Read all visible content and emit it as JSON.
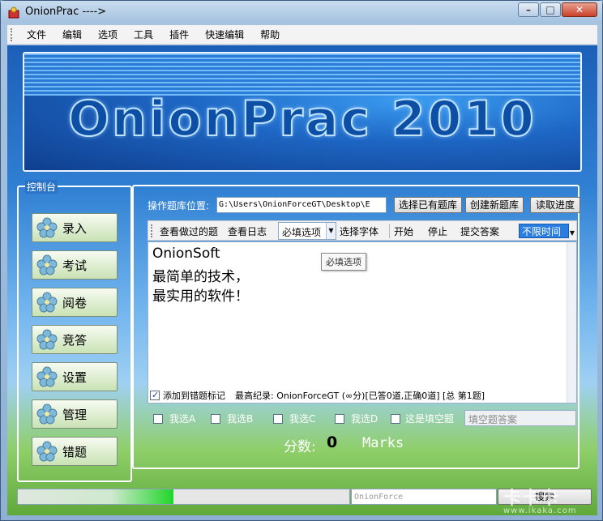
{
  "window": {
    "title": "OnionPrac ---->",
    "accent_color": "#2a7de1"
  },
  "menu": [
    "文件",
    "编辑",
    "选项",
    "工具",
    "插件",
    "快速编辑",
    "帮助"
  ],
  "banner": {
    "title": "OnionPrac 2010"
  },
  "console": {
    "title": "控制台",
    "buttons": [
      "录入",
      "考试",
      "阅卷",
      "竞答",
      "设置",
      "管理",
      "错题"
    ]
  },
  "workspace": {
    "path_label": "操作题库位置:",
    "path_value": "G:\\Users\\OnionForceGT\\Desktop\\E",
    "buttons": {
      "select_existing": "选择已有题库",
      "create_new": "创建新题库",
      "read_progress": "读取进度"
    },
    "toolbar": {
      "view_done": "查看做过的题",
      "view_log": "查看日志",
      "required_option": "必填选项",
      "select_font": "选择字体",
      "start": "开始",
      "stop": "停止",
      "submit": "提交答案",
      "time": "不限时间"
    },
    "tooltip": "必填选项",
    "question_lines": [
      "OnionSoft",
      "最简单的技术，",
      "最实用的软件！"
    ],
    "mark_label": "添加到错题标记",
    "record": "最高纪录:  OnionForceGT   (∞分)[已答0道,正确0道] [总 第1题]",
    "choices": [
      "我选A",
      "我选B",
      "我选C",
      "我选D",
      "这是填空题"
    ],
    "fill_placeholder": "填空题答案",
    "score_label": "分数:",
    "score_value": "0",
    "score_unit": "Marks"
  },
  "status": {
    "progress": 0.47,
    "text": "OnionForce",
    "search_label": "搜索"
  },
  "watermark": {
    "brand": "卡卡卡",
    "site": "www.ikaka.com"
  }
}
